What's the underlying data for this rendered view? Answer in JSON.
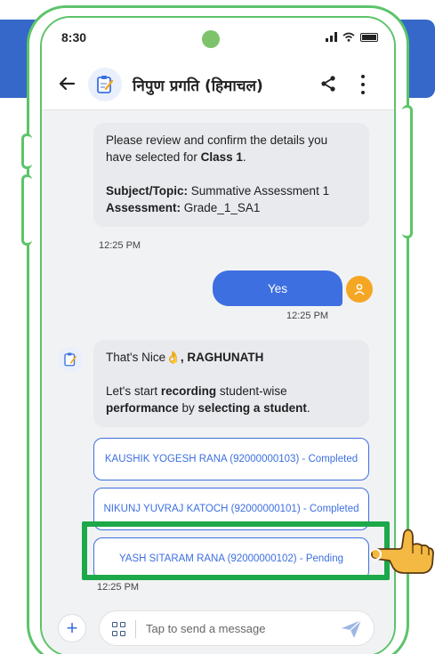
{
  "status_bar": {
    "time": "8:30"
  },
  "header": {
    "title": "निपुण प्रगति (हिमाचल)"
  },
  "messages": {
    "review": {
      "line1": "Please review and confirm the details you have selected for ",
      "class_label": "Class 1",
      "period": ".",
      "subject_key": "Subject/Topic:",
      "subject_value": " Summative Assessment 1",
      "assessment_key": "Assessment:",
      "assessment_value": " Grade_1_SA1",
      "time": "12:25 PM"
    },
    "user_reply": {
      "text": "Yes",
      "time": "12:25 PM"
    },
    "greeting": {
      "prefix": "That's Nice",
      "emoji": "👌",
      "name": ", RAGHUNATH",
      "part1": "Let's start ",
      "bold1": "recording",
      "part2": " student-wise ",
      "bold2": "performance",
      "part3": " by ",
      "bold3": "selecting a student",
      "part4": "."
    },
    "options": [
      {
        "label": "KAUSHIK YOGESH RANA (92000000103) - Completed"
      },
      {
        "label": "NIKUNJ YUVRAJ KATOCH (92000000101) - Completed"
      },
      {
        "label": "YASH SITARAM RANA (92000000102) - Pending"
      }
    ],
    "last_time": "12:25 PM"
  },
  "input": {
    "placeholder": "Tap to send a message",
    "value": ""
  },
  "colors": {
    "frame": "#5cc46a",
    "accent_blue": "#3d6fe0",
    "highlight": "#1da84a",
    "user_avatar": "#f5a623"
  },
  "icons": [
    "back-arrow-icon",
    "bot-avatar-icon",
    "share-icon",
    "more-vertical-icon",
    "user-avatar-icon",
    "pointing-hand-icon",
    "plus-icon",
    "grid-icon",
    "send-icon"
  ]
}
